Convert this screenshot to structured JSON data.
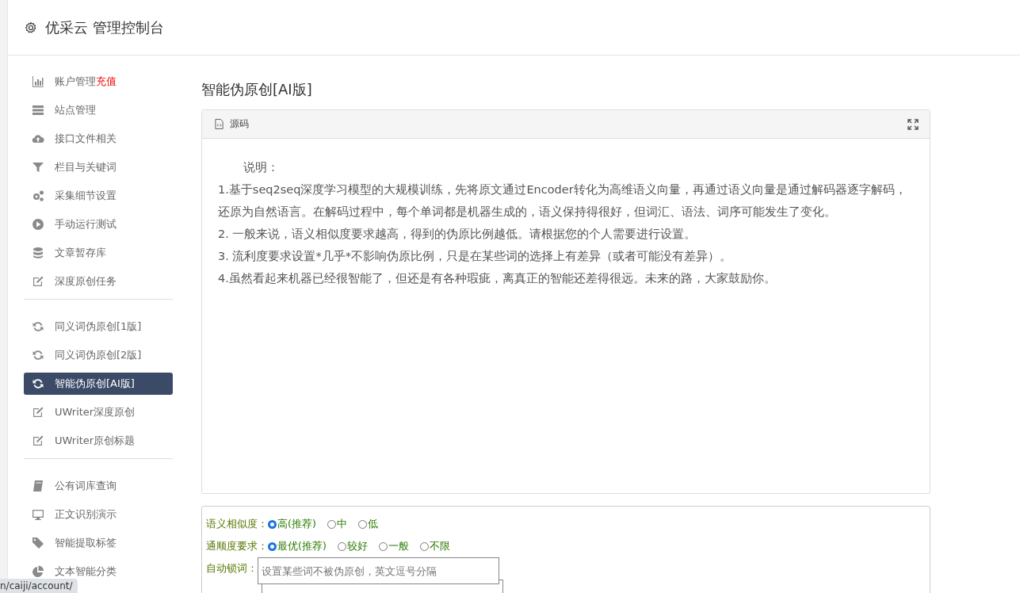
{
  "header": {
    "title": "优采云 管理控制台"
  },
  "sidebar": {
    "groups": [
      [
        {
          "label": "账户管理",
          "badge": "充值",
          "selected": false
        },
        {
          "label": "站点管理",
          "selected": false
        },
        {
          "label": "接口文件相关",
          "selected": false
        },
        {
          "label": "栏目与关键词",
          "selected": false
        },
        {
          "label": "采集细节设置",
          "selected": false
        },
        {
          "label": "手动运行测试",
          "selected": false
        },
        {
          "label": "文章暂存库",
          "selected": false
        },
        {
          "label": "深度原创任务",
          "selected": false
        }
      ],
      [
        {
          "label": "同义词伪原创[1版]",
          "selected": false
        },
        {
          "label": "同义词伪原创[2版]",
          "selected": false
        },
        {
          "label": "智能伪原创[AI版]",
          "selected": true
        },
        {
          "label": "UWriter深度原创",
          "selected": false
        },
        {
          "label": "UWriter原创标题",
          "selected": false
        }
      ],
      [
        {
          "label": "公有词库查询",
          "selected": false
        },
        {
          "label": "正文识别演示",
          "selected": false
        },
        {
          "label": "智能提取标签",
          "selected": false
        },
        {
          "label": "文本智能分类",
          "selected": false
        }
      ]
    ]
  },
  "page_title": "智能伪原创[AI版]",
  "source_panel": {
    "title": "源码",
    "heading": "说明：",
    "paragraphs": [
      "1.基于seq2seq深度学习模型的大规模训练，先将原文通过Encoder转化为高维语义向量，再通过语义向量是通过解码器逐字解码，还原为自然语言。在解码过程中，每个单词都是机器生成的，语义保持得很好，但词汇、语法、词序可能发生了变化。",
      "2. 一般来说，语义相似度要求越高，得到的伪原比例越低。请根据您的个人需要进行设置。",
      "3. 流利度要求设置*几乎*不影响伪原比例，只是在某些词的选择上有差异（或者可能没有差异）。",
      "4.虽然看起来机器已经很智能了，但还是有各种瑕疵，离真正的智能还差得很远。未来的路，大家鼓励你。"
    ]
  },
  "options": [
    {
      "label": "语义相似度：",
      "choices": [
        {
          "label": "高(推荐)",
          "selected": true
        },
        {
          "label": "中",
          "selected": false
        },
        {
          "label": "低",
          "selected": false
        }
      ]
    },
    {
      "label": "通顺度要求：",
      "choices": [
        {
          "label": "最优(推荐)",
          "selected": true
        },
        {
          "label": "较好",
          "selected": false
        },
        {
          "label": "一般",
          "selected": false
        },
        {
          "label": "不限",
          "selected": false
        }
      ]
    }
  ],
  "lock_words": {
    "label": "自动锁词：",
    "placeholder": "设置某些词不被伪原创，英文逗号分隔"
  },
  "status_bar": {
    "url": "n/caiji/account/"
  }
}
